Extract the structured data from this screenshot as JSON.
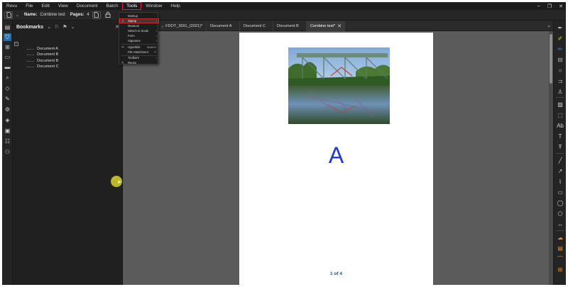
{
  "menubar": {
    "items": [
      "Revu",
      "File",
      "Edit",
      "View",
      "Document",
      "Batch",
      "Tools",
      "Window",
      "Help"
    ]
  },
  "window_controls": {
    "minimize": "–",
    "restore": "❐",
    "close": "✕"
  },
  "toolbar": {
    "name_label": "Name:",
    "name_value": "Combine test",
    "pages_label": "Pages:",
    "pages_value": "4"
  },
  "tools_menu": {
    "items": [
      {
        "label": "Markup",
        "arrow": ""
      },
      {
        "label": "Stamp",
        "arrow": "›",
        "highlighted": true
      },
      {
        "label": "Measure",
        "arrow": ""
      },
      {
        "label": "Sketch to Scale",
        "arrow": "›"
      },
      {
        "label": "Form",
        "arrow": "›"
      },
      {
        "label": "Signature",
        "arrow": "›"
      },
      {
        "label": "Hyperlink",
        "shortcut": "Shift+H"
      },
      {
        "label": "File Attachment",
        "shortcut": "F"
      },
      {
        "label": "Toolbars",
        "arrow": "›"
      },
      {
        "label": "Reuse",
        "arrow": ""
      }
    ]
  },
  "panel": {
    "title": "Bookmarks",
    "bookmarks": [
      "Document A",
      "Document B",
      "Document B",
      "Document C"
    ]
  },
  "tabs": [
    {
      "label": "FDOT_SDG_(2021)*"
    },
    {
      "label": "Document A"
    },
    {
      "label": "Document C"
    },
    {
      "label": "Document B"
    },
    {
      "label": "Combine test*",
      "active": true,
      "close": "✕"
    }
  ],
  "page": {
    "letter": "A",
    "page_indicator": "1 of 4"
  },
  "colors": {
    "accent_blue": "#1f6fb5",
    "highlight_red": "#e0202a",
    "letter_blue": "#1f35d6",
    "cursor_yellow": "#d8d32a"
  }
}
